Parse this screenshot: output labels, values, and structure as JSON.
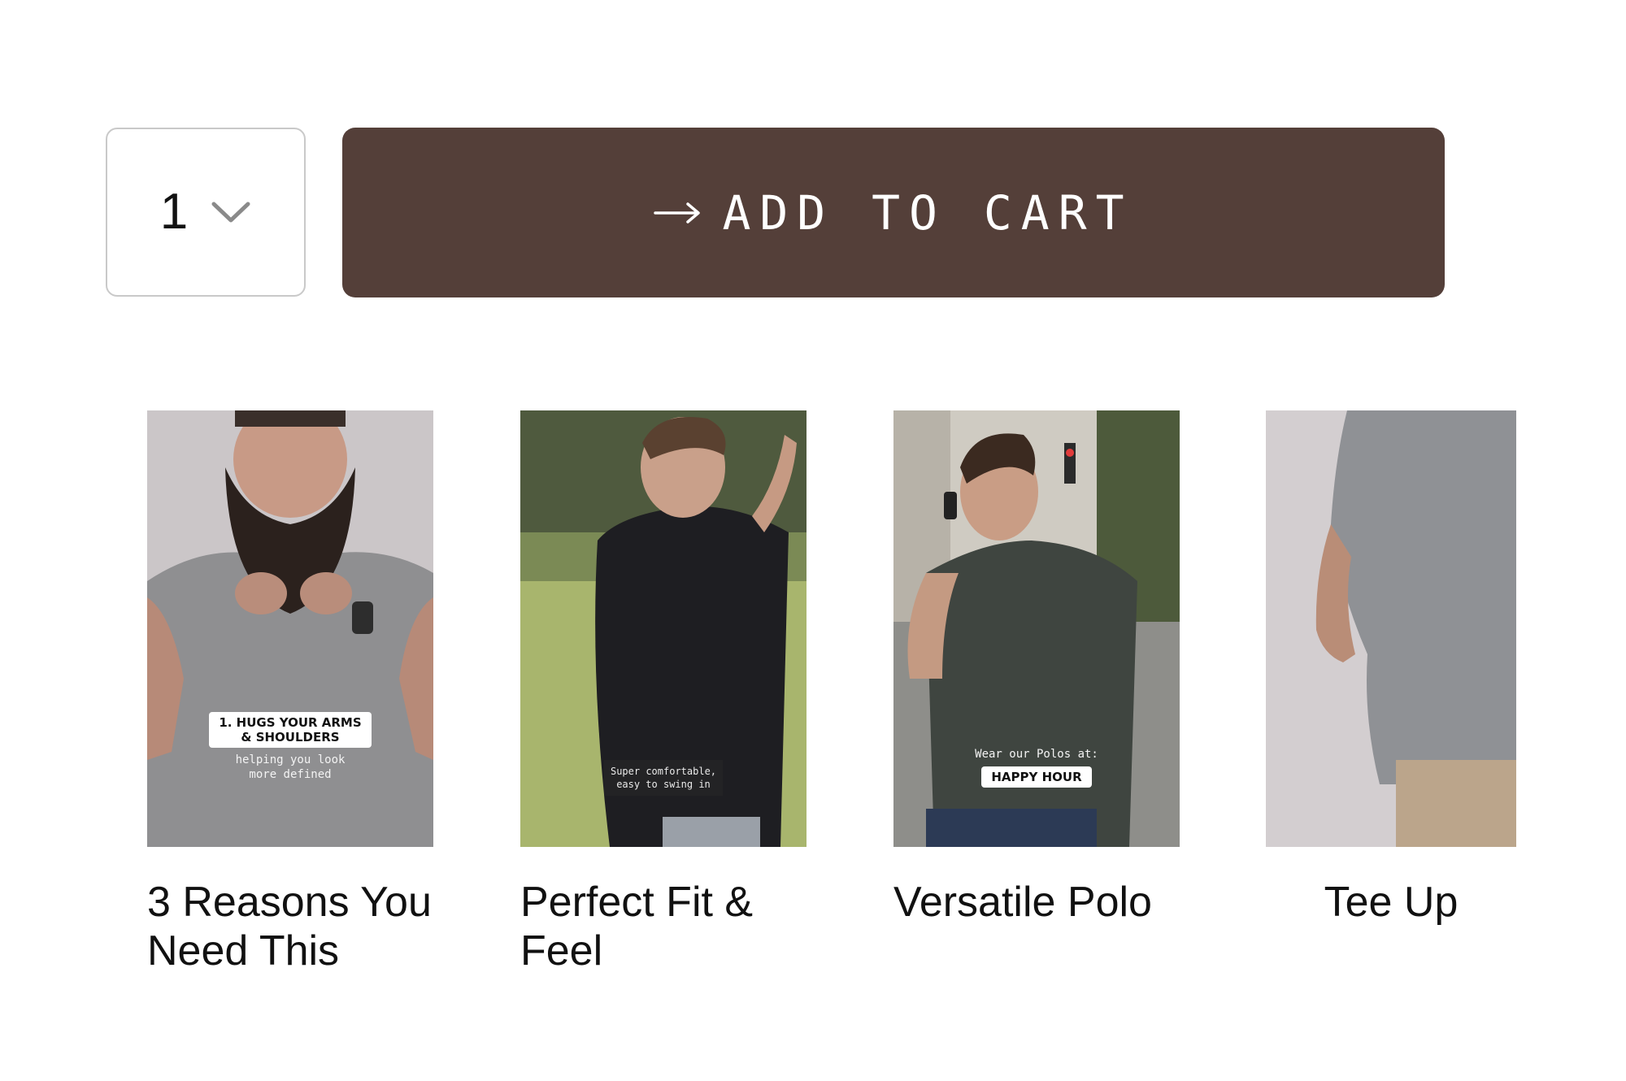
{
  "purchase": {
    "quantity": "1",
    "add_to_cart_label": "ADD TO CART",
    "arrow_icon": "arrow-right-icon",
    "chevron_icon": "chevron-down-icon",
    "button_color": "#543f39"
  },
  "videos": [
    {
      "title": "3 Reasons You Need This",
      "overlay_chip": "1. HUGS YOUR ARMS\n& SHOULDERS",
      "overlay_caption": "helping you look\nmore defined"
    },
    {
      "title": "Perfect Fit & Feel",
      "overlay_caption": "Super comfortable,\neasy to swing in"
    },
    {
      "title": "Versatile Polo",
      "overlay_caption": "Wear our Polos at:",
      "overlay_chip": "HAPPY HOUR"
    },
    {
      "title": "Tee Up"
    }
  ]
}
